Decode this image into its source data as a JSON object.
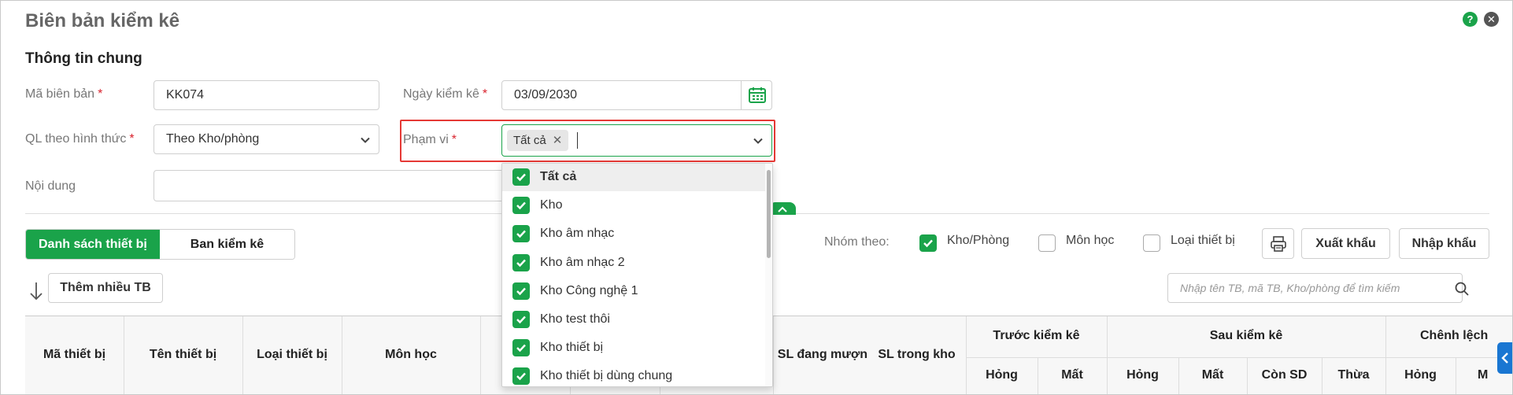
{
  "window": {
    "title": "Biên bản kiểm kê"
  },
  "section": {
    "title": "Thông tin chung"
  },
  "form": {
    "ma_bien_ban": {
      "label": "Mã biên bản",
      "required": "*",
      "value": "KK074"
    },
    "ngay_kiem_ke": {
      "label": "Ngày kiểm kê",
      "required": "*",
      "value": "03/09/2030"
    },
    "ql_hinh_thuc": {
      "label": "QL theo hình thức",
      "required": "*",
      "value": "Theo Kho/phòng"
    },
    "pham_vi": {
      "label": "Phạm vi",
      "required": "*",
      "tag": "Tất cả"
    },
    "noi_dung": {
      "label": "Nội dung",
      "value": ""
    }
  },
  "dropdown": {
    "options": [
      "Tất cả",
      "Kho",
      "Kho âm nhạc",
      "Kho âm nhạc 2",
      "Kho Công nghệ 1",
      "Kho test thôi",
      "Kho thiết bị",
      "Kho thiết bị dùng chung"
    ]
  },
  "tabs": {
    "devices": "Danh sách thiết bị",
    "committee": "Ban kiểm kê"
  },
  "group_by": {
    "label": "Nhóm theo:",
    "options": [
      {
        "label": "Kho/Phòng",
        "checked": true
      },
      {
        "label": "Môn học",
        "checked": false
      },
      {
        "label": "Loại thiết bị",
        "checked": false
      }
    ]
  },
  "toolbar": {
    "export": "Xuất khẩu",
    "import": "Nhập khẩu",
    "add_many": "Thêm nhiều TB"
  },
  "search": {
    "placeholder": "Nhập tên TB, mã TB, Kho/phòng để tìm kiếm"
  },
  "table": {
    "headers": {
      "ma_thiet_bi": "Mã thiết bị",
      "ten_thiet_bi": "Tên thiết bị",
      "loai_thiet_bi": "Loại thiết bị",
      "mon_hoc": "Môn học",
      "sl_dang_muon": "SL đang mượn",
      "sl_trong_kho": "SL trong kho",
      "truoc_kiem_ke": "Trước kiểm kê",
      "sau_kiem_ke": "Sau kiểm kê",
      "chenh_lech": "Chênh lệch",
      "hong": "Hỏng",
      "mat": "Mất",
      "con_sd": "Còn SD",
      "thua": "Thừa",
      "m_partial": "M"
    }
  },
  "colors": {
    "accent": "#1aa34a",
    "danger": "#e53935",
    "side_tab": "#1976d2"
  },
  "icons": [
    "help-icon",
    "close-icon",
    "calendar-icon",
    "chevron-down-icon",
    "check-icon",
    "print-icon",
    "search-icon",
    "sort-down-icon",
    "chevron-up-icon",
    "chevron-left-icon"
  ]
}
